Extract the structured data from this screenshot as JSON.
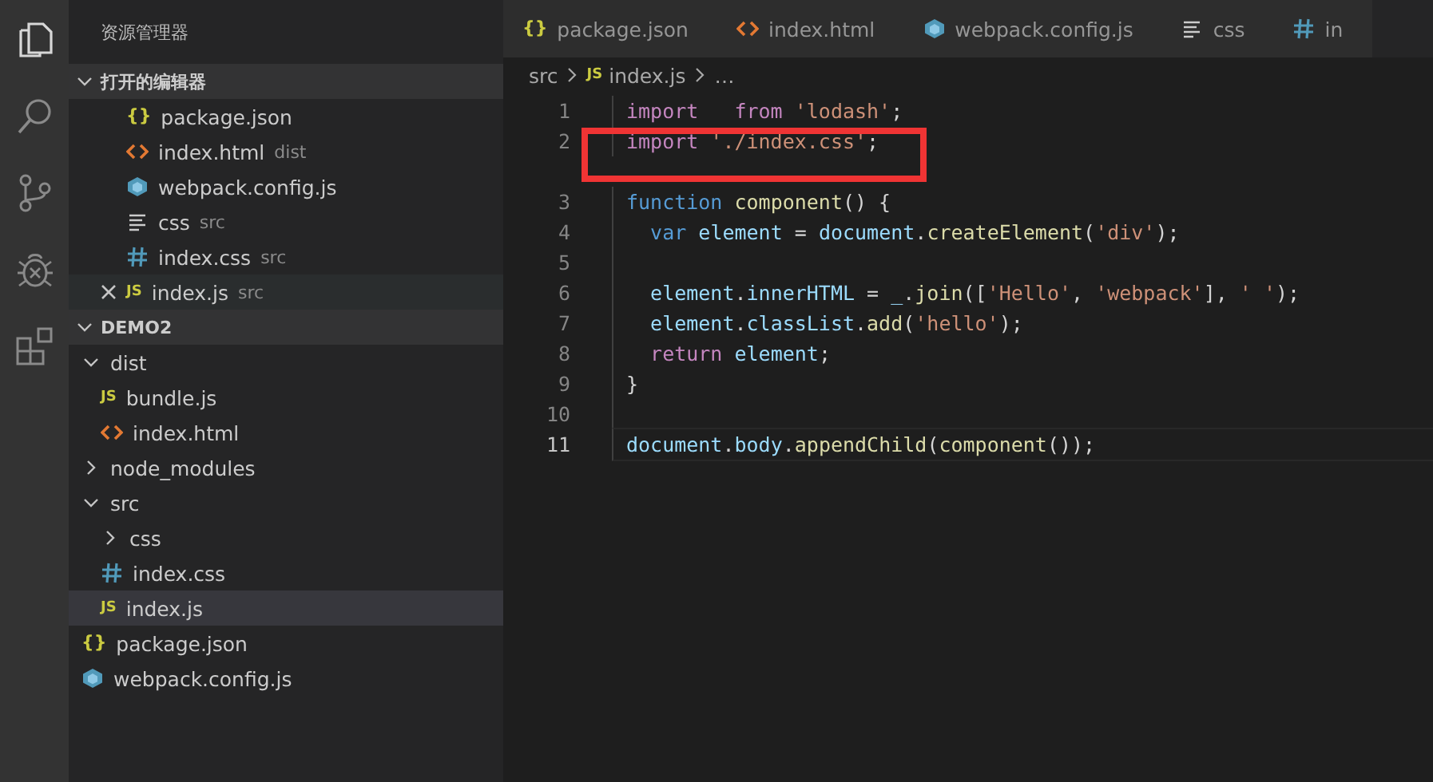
{
  "sidebar": {
    "title": "资源管理器",
    "open_editors": {
      "label": "打开的编辑器",
      "expanded": true,
      "items": [
        {
          "name": "package.json",
          "kind": "json",
          "icon_label": "{}",
          "hovered": false
        },
        {
          "name": "index.html",
          "description": "dist",
          "kind": "html",
          "hovered": false
        },
        {
          "name": "webpack.config.js",
          "kind": "webpack",
          "hovered": false
        },
        {
          "name": "css",
          "description": "src",
          "kind": "text",
          "hovered": false
        },
        {
          "name": "index.css",
          "description": "src",
          "kind": "css",
          "hovered": false
        },
        {
          "name": "index.js",
          "description": "src",
          "kind": "js",
          "icon_label": "JS",
          "hovered": true
        }
      ]
    },
    "project": {
      "label": "DEMO2",
      "expanded": true,
      "items": [
        {
          "name": "dist",
          "kind": "folder",
          "expanded": true,
          "selected": false,
          "children": [
            {
              "name": "bundle.js",
              "kind": "js",
              "icon_label": "JS",
              "selected": false
            },
            {
              "name": "index.html",
              "kind": "html",
              "selected": false
            }
          ]
        },
        {
          "name": "node_modules",
          "kind": "folder",
          "expanded": false,
          "selected": false
        },
        {
          "name": "src",
          "kind": "folder",
          "expanded": true,
          "selected": false,
          "children": [
            {
              "name": "css",
              "kind": "folder",
              "expanded": false,
              "selected": false
            },
            {
              "name": "index.css",
              "kind": "css",
              "selected": false
            },
            {
              "name": "index.js",
              "kind": "js",
              "icon_label": "JS",
              "selected": true
            }
          ]
        },
        {
          "name": "package.json",
          "kind": "json",
          "icon_label": "{}",
          "selected": false
        },
        {
          "name": "webpack.config.js",
          "kind": "webpack",
          "selected": false
        }
      ]
    }
  },
  "tabs": [
    {
      "label": "package.json",
      "kind": "json",
      "icon_label": "{}"
    },
    {
      "label": "index.html",
      "kind": "html"
    },
    {
      "label": "webpack.config.js",
      "kind": "webpack"
    },
    {
      "label": "css",
      "kind": "text"
    },
    {
      "label": "in",
      "kind": "css"
    }
  ],
  "breadcrumb": [
    {
      "label": "src",
      "kind": "none"
    },
    {
      "label": "index.js",
      "kind": "js",
      "icon_label": "JS"
    },
    {
      "label": "…",
      "kind": "none"
    }
  ],
  "code": [
    {
      "number": "1",
      "current": false,
      "tokens": [
        {
          "kind": "keyword",
          "text": "import"
        },
        {
          "kind": "keyword",
          "text": "   from"
        },
        {
          "kind": "string",
          "text": " 'lodash'"
        },
        {
          "kind": "plain",
          "text": ";"
        }
      ]
    },
    {
      "number": "2",
      "current": false,
      "codelens": true,
      "tokens": [
        {
          "kind": "keyword",
          "text": "import"
        },
        {
          "kind": "string",
          "text": " './index.css'"
        },
        {
          "kind": "plain",
          "text": ";"
        }
      ]
    },
    {
      "number": "3",
      "current": false,
      "tokens": [
        {
          "kind": "storage",
          "text": "function"
        },
        {
          "kind": "func",
          "text": " component"
        },
        {
          "kind": "plain",
          "text": "() {"
        }
      ]
    },
    {
      "number": "4",
      "current": false,
      "tokens": [
        {
          "kind": "storage",
          "text": "  var"
        },
        {
          "kind": "var",
          "text": " element"
        },
        {
          "kind": "plain",
          "text": " ="
        },
        {
          "kind": "var",
          "text": " document"
        },
        {
          "kind": "plain",
          "text": "."
        },
        {
          "kind": "func",
          "text": "createElement"
        },
        {
          "kind": "plain",
          "text": "("
        },
        {
          "kind": "string",
          "text": "'div'"
        },
        {
          "kind": "plain",
          "text": ");"
        }
      ]
    },
    {
      "number": "5",
      "current": false
    },
    {
      "number": "6",
      "current": false,
      "tokens": [
        {
          "kind": "var",
          "text": "  element"
        },
        {
          "kind": "plain",
          "text": "."
        },
        {
          "kind": "var",
          "text": "innerHTML"
        },
        {
          "kind": "plain",
          "text": " ="
        },
        {
          "kind": "var",
          "text": " _"
        },
        {
          "kind": "plain",
          "text": "."
        },
        {
          "kind": "func",
          "text": "join"
        },
        {
          "kind": "plain",
          "text": "(["
        },
        {
          "kind": "string",
          "text": "'Hello'"
        },
        {
          "kind": "plain",
          "text": ","
        },
        {
          "kind": "string",
          "text": " 'webpack'"
        },
        {
          "kind": "plain",
          "text": "],"
        },
        {
          "kind": "string",
          "text": " ' '"
        },
        {
          "kind": "plain",
          "text": ");"
        }
      ]
    },
    {
      "number": "7",
      "current": false,
      "tokens": [
        {
          "kind": "var",
          "text": "  element"
        },
        {
          "kind": "plain",
          "text": "."
        },
        {
          "kind": "var",
          "text": "classList"
        },
        {
          "kind": "plain",
          "text": "."
        },
        {
          "kind": "func",
          "text": "add"
        },
        {
          "kind": "plain",
          "text": "("
        },
        {
          "kind": "string",
          "text": "'hello'"
        },
        {
          "kind": "plain",
          "text": ");"
        }
      ]
    },
    {
      "number": "8",
      "current": false,
      "tokens": [
        {
          "kind": "keyword",
          "text": "  return"
        },
        {
          "kind": "var",
          "text": " element"
        },
        {
          "kind": "plain",
          "text": ";"
        }
      ]
    },
    {
      "number": "9",
      "current": false,
      "tokens": [
        {
          "kind": "plain",
          "text": "}"
        }
      ]
    },
    {
      "number": "10",
      "current": false
    },
    {
      "number": "11",
      "current": true,
      "tokens": [
        {
          "kind": "var",
          "text": "document"
        },
        {
          "kind": "plain",
          "text": "."
        },
        {
          "kind": "var",
          "text": "body"
        },
        {
          "kind": "plain",
          "text": "."
        },
        {
          "kind": "func",
          "text": "appendChild"
        },
        {
          "kind": "plain",
          "text": "("
        },
        {
          "kind": "func",
          "text": "component"
        },
        {
          "kind": "plain",
          "text": "());"
        }
      ]
    }
  ]
}
